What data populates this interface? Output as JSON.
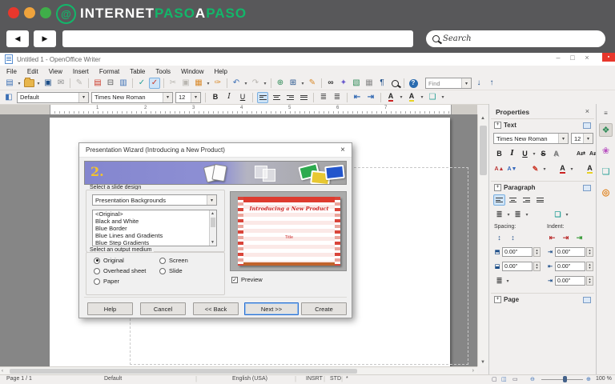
{
  "browser": {
    "brand": [
      "INTERNET",
      "PASO",
      "A",
      "PASO"
    ],
    "search_label": "Search"
  },
  "window": {
    "title": "Untitled 1 - OpenOffice Writer"
  },
  "menus": [
    "File",
    "Edit",
    "View",
    "Insert",
    "Format",
    "Table",
    "Tools",
    "Window",
    "Help"
  ],
  "toolbar": {
    "find_label": "Find"
  },
  "formatting": {
    "style": "Default",
    "font": "Times New Roman",
    "size": "12"
  },
  "glyphs": {
    "bold": "B",
    "italic": "I",
    "underline": "U",
    "strike": "S",
    "shadow": "A",
    "minimize": "–",
    "maximize": "□",
    "close": "×",
    "back": "◀",
    "forward": "▶",
    "at": "@",
    "a_letter": "A",
    "square": "▪"
  },
  "ruler": [
    "1",
    "2",
    "3",
    "4",
    "5",
    "6",
    "7"
  ],
  "icons": {
    "new": "▤",
    "save": "▣",
    "email": "✉",
    "edit": "✎",
    "pdf": "▤",
    "print": "⊟",
    "preview": "▥",
    "spell": "✓",
    "autospell": "✓",
    "cut": "✂",
    "copy": "▣",
    "paste": "▦",
    "brush": "✑",
    "undo": "↶",
    "redo": "↷",
    "hyperlink": "⊕",
    "table": "⊞",
    "draw": "✎",
    "find": "∞",
    "navigator": "✦",
    "gallery": "▧",
    "datasources": "▦",
    "pilcrow": "¶",
    "help": "?",
    "find_down": "↓",
    "find_up": "↑",
    "styles": "◧",
    "numlist": "≣",
    "bullist": "≣",
    "dec_indent": "⇤",
    "inc_indent": "⇥",
    "bgbox": "❑",
    "spacing_a": "↕",
    "spacing_b": "↕",
    "indent_a": "⇤",
    "indent_b": "⇥",
    "indent_c": "⇥",
    "linespace": "≣",
    "char_sp1": "A⇄",
    "char_sp2": "A⇄",
    "font_up": "A▲",
    "font_dn": "A▼",
    "char_hl": "✎",
    "up_arrow": "▲",
    "dn_arrow": "▼",
    "page_single": "▢",
    "page_multi": "◫",
    "page_book": "▭",
    "zoom_out": "⊖",
    "zoom_in": "⊕",
    "tab_properties": "❖",
    "tab_gallery": "❀",
    "tab_clipart": "❏",
    "tab_navigator": "◎",
    "sidebar_settings": "≡"
  },
  "dialog": {
    "title": "Presentation Wizard (Introducing a New Product)",
    "step": "2.",
    "design_group": "Select a slide design",
    "design_combo": "Presentation Backgrounds",
    "design_list": [
      "<Original>",
      "Black and White",
      "Blue Border",
      "Blue Lines and Gradients",
      "Blue Step Gradients"
    ],
    "output_group": "Select an output medium",
    "outputs_left": [
      "Original",
      "Overhead sheet",
      "Paper"
    ],
    "outputs_right": [
      "Screen",
      "Slide"
    ],
    "preview_label": "Preview",
    "preview_check": "✓",
    "slide": {
      "title": "Introducing a New Product",
      "subtitle": "Title"
    },
    "buttons": {
      "help": "Help",
      "cancel": "Cancel",
      "back": "<< Back",
      "next": "Next >>",
      "create": "Create"
    }
  },
  "sidebar": {
    "title": "Properties",
    "text_section": "Text",
    "paragraph_section": "Paragraph",
    "page_section": "Page",
    "font": "Times New Roman",
    "size": "12",
    "spacing_label": "Spacing:",
    "indent_label": "Indent:",
    "spin": {
      "above": "0.00\"",
      "below": "0.00\"",
      "before": "0.00\"",
      "after": "0.00\"",
      "first": "0.00\""
    }
  },
  "statusbar": {
    "page": "Page 1 / 1",
    "style": "Default",
    "language": "English (USA)",
    "insert": "INSRT",
    "selection": "STD",
    "modified": "*",
    "zoom": "100 %"
  }
}
